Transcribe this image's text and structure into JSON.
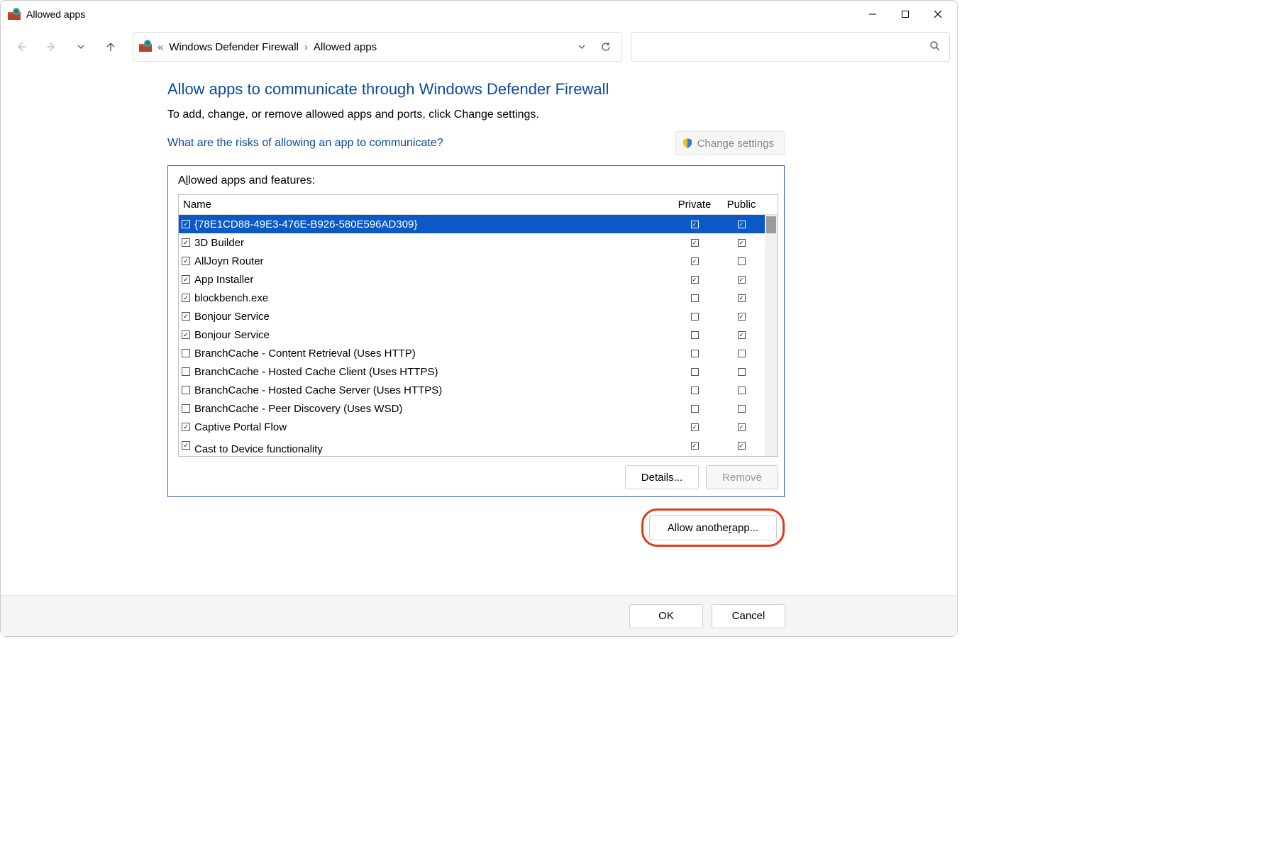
{
  "window": {
    "title": "Allowed apps"
  },
  "breadcrumb": {
    "prefix": "«",
    "items": [
      "Windows Defender Firewall",
      "Allowed apps"
    ]
  },
  "page": {
    "heading": "Allow apps to communicate through Windows Defender Firewall",
    "subtext": "To add, change, or remove allowed apps and ports, click Change settings.",
    "risks_link": "What are the risks of allowing an app to communicate?",
    "change_settings": "Change settings",
    "panel_label_pre": "A",
    "panel_label_ul": "l",
    "panel_label_post": "lowed apps and features:",
    "headers": {
      "name": "Name",
      "private": "Private",
      "public": "Public"
    },
    "details": "Details...",
    "remove": "Remove",
    "allow_pre": "Allow anothe",
    "allow_ul": "r",
    "allow_post": " app...",
    "ok": "OK",
    "cancel": "Cancel"
  },
  "rows": [
    {
      "enabled": true,
      "name": "{78E1CD88-49E3-476E-B926-580E596AD309}",
      "private": true,
      "public": true,
      "selected": true
    },
    {
      "enabled": true,
      "name": "3D Builder",
      "private": true,
      "public": true
    },
    {
      "enabled": true,
      "name": "AllJoyn Router",
      "private": true,
      "public": false
    },
    {
      "enabled": true,
      "name": "App Installer",
      "private": true,
      "public": true
    },
    {
      "enabled": true,
      "name": "blockbench.exe",
      "private": false,
      "public": true
    },
    {
      "enabled": true,
      "name": "Bonjour Service",
      "private": false,
      "public": true
    },
    {
      "enabled": true,
      "name": "Bonjour Service",
      "private": false,
      "public": true
    },
    {
      "enabled": false,
      "name": "BranchCache - Content Retrieval (Uses HTTP)",
      "private": false,
      "public": false
    },
    {
      "enabled": false,
      "name": "BranchCache - Hosted Cache Client (Uses HTTPS)",
      "private": false,
      "public": false
    },
    {
      "enabled": false,
      "name": "BranchCache - Hosted Cache Server (Uses HTTPS)",
      "private": false,
      "public": false
    },
    {
      "enabled": false,
      "name": "BranchCache - Peer Discovery (Uses WSD)",
      "private": false,
      "public": false
    },
    {
      "enabled": true,
      "name": "Captive Portal Flow",
      "private": true,
      "public": true
    },
    {
      "enabled": true,
      "name": "Cast to Device functionality",
      "private": true,
      "public": true,
      "lastcut": true
    }
  ]
}
